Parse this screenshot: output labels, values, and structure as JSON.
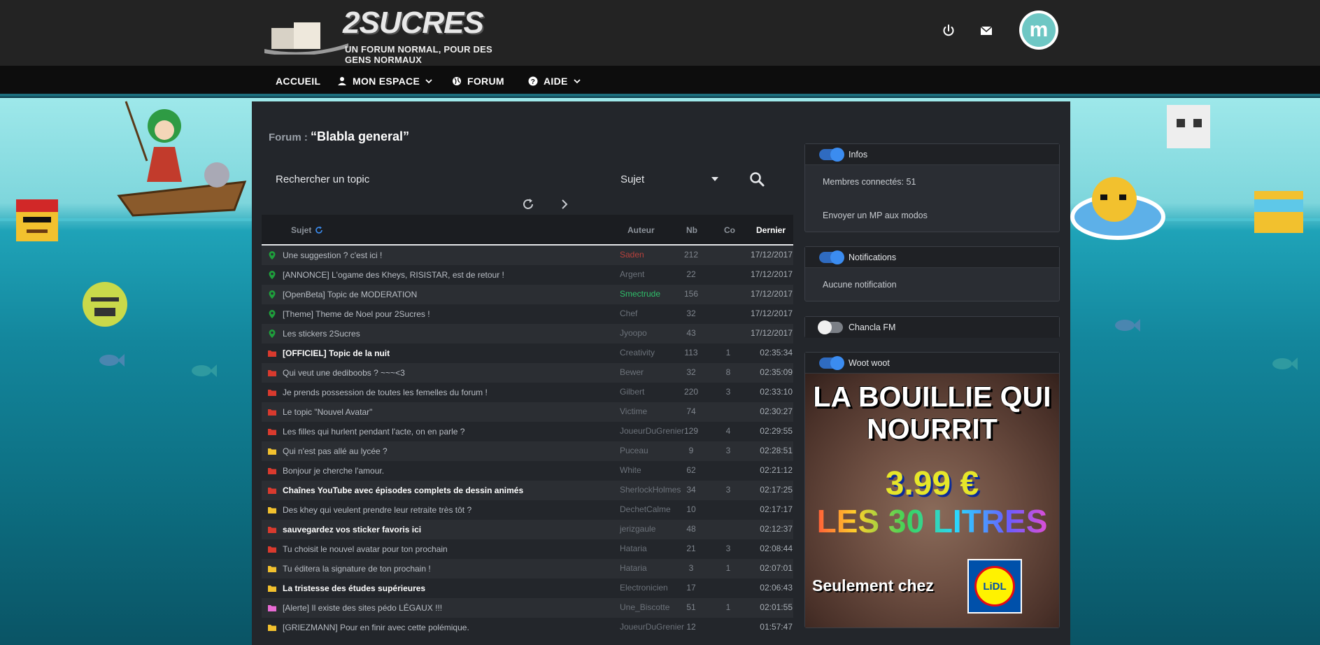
{
  "site": {
    "title": "2SUCRES",
    "tagline": "UN FORUM NORMAL, POUR DES GENS NORMAUX",
    "avatar_letter": "m"
  },
  "nav": {
    "home": "ACCUEIL",
    "space": "MON ESPACE",
    "forum": "FORUM",
    "help": "AIDE"
  },
  "breadcrumb": {
    "prefix": "Forum :",
    "title": "“Blabla general”"
  },
  "search": {
    "label": "Rechercher un topic",
    "field_value": "Sujet"
  },
  "table": {
    "headers": {
      "subject": "Sujet",
      "author": "Auteur",
      "nb": "Nb",
      "co": "Co",
      "last": "Dernier"
    },
    "rows": [
      {
        "icon": "pin",
        "color": "#1f9e3c",
        "subject": "Une suggestion ? c'est ici !",
        "bold": false,
        "author": "Saden",
        "author_color": "#b8413c",
        "nb": "212",
        "co": "",
        "date": "17/12/2017"
      },
      {
        "icon": "pin",
        "color": "#1f9e3c",
        "subject": "[ANNONCE] L'ogame des Kheys, RISISTAR, est de retour !",
        "bold": false,
        "author": "Argent",
        "author_color": "",
        "nb": "22",
        "co": "",
        "date": "17/12/2017"
      },
      {
        "icon": "pin",
        "color": "#1f9e3c",
        "subject": "[OpenBeta] Topic de MODERATION",
        "bold": false,
        "author": "Smectrude",
        "author_color": "#2fbf6a",
        "nb": "156",
        "co": "",
        "date": "17/12/2017"
      },
      {
        "icon": "pin",
        "color": "#1f9e3c",
        "subject": "[Theme] Theme de Noel pour 2Sucres !",
        "bold": false,
        "author": "Chef",
        "author_color": "",
        "nb": "32",
        "co": "",
        "date": "17/12/2017"
      },
      {
        "icon": "pin",
        "color": "#1f9e3c",
        "subject": "Les stickers 2Sucres",
        "bold": false,
        "author": "Jyoopo",
        "author_color": "",
        "nb": "43",
        "co": "",
        "date": "17/12/2017"
      },
      {
        "icon": "folder",
        "color": "#d93a2e",
        "subject": "[OFFICIEL] Topic de la nuit",
        "bold": true,
        "author": "Creativity",
        "author_color": "",
        "nb": "113",
        "co": "1",
        "date": "02:35:34"
      },
      {
        "icon": "folder",
        "color": "#d93a2e",
        "subject": "Qui veut une dediboobs ? ~~~<3",
        "bold": false,
        "author": "Bewer",
        "author_color": "",
        "nb": "32",
        "co": "8",
        "date": "02:35:09"
      },
      {
        "icon": "folder",
        "color": "#d93a2e",
        "subject": "Je prends possession de toutes les femelles du forum !",
        "bold": false,
        "author": "Gilbert",
        "author_color": "",
        "nb": "220",
        "co": "3",
        "date": "02:33:10"
      },
      {
        "icon": "folder",
        "color": "#d93a2e",
        "subject": "Le topic \"Nouvel Avatar\"",
        "bold": false,
        "author": "Victime",
        "author_color": "",
        "nb": "74",
        "co": "",
        "date": "02:30:27"
      },
      {
        "icon": "folder",
        "color": "#d93a2e",
        "subject": "Les filles qui hurlent pendant l'acte, on en parle ?",
        "bold": false,
        "author": "JoueurDuGrenier",
        "author_color": "",
        "nb": "129",
        "co": "4",
        "date": "02:29:55"
      },
      {
        "icon": "folder",
        "color": "#f2c12e",
        "subject": "Qui n'est pas allé au lycée ?",
        "bold": false,
        "author": "Puceau",
        "author_color": "",
        "nb": "9",
        "co": "3",
        "date": "02:28:51"
      },
      {
        "icon": "folder",
        "color": "#d93a2e",
        "subject": "Bonjour je cherche l'amour.",
        "bold": false,
        "author": "White",
        "author_color": "",
        "nb": "62",
        "co": "",
        "date": "02:21:12"
      },
      {
        "icon": "folder",
        "color": "#d93a2e",
        "subject": "Chaînes YouTube avec épisodes complets de dessin animés",
        "bold": true,
        "author": "SherlockHolmes",
        "author_color": "",
        "nb": "34",
        "co": "3",
        "date": "02:17:25"
      },
      {
        "icon": "folder",
        "color": "#f2c12e",
        "subject": "Des khey qui veulent prendre leur retraite très tôt ?",
        "bold": false,
        "author": "DechetCalme",
        "author_color": "",
        "nb": "10",
        "co": "",
        "date": "02:17:17"
      },
      {
        "icon": "folder",
        "color": "#d93a2e",
        "subject": "sauvegardez vos sticker favoris ici",
        "bold": true,
        "author": "jerizgaule",
        "author_color": "",
        "nb": "48",
        "co": "",
        "date": "02:12:37"
      },
      {
        "icon": "folder",
        "color": "#d93a2e",
        "subject": "Tu choisit le nouvel avatar pour ton prochain",
        "bold": false,
        "author": "Hataria",
        "author_color": "",
        "nb": "21",
        "co": "3",
        "date": "02:08:44"
      },
      {
        "icon": "folder",
        "color": "#f2c12e",
        "subject": "Tu éditera la signature de ton prochain !",
        "bold": false,
        "author": "Hataria",
        "author_color": "",
        "nb": "3",
        "co": "1",
        "date": "02:07:01"
      },
      {
        "icon": "folder",
        "color": "#f2c12e",
        "subject": "La tristesse des études supérieures",
        "bold": true,
        "author": "Electronicien",
        "author_color": "",
        "nb": "17",
        "co": "",
        "date": "02:06:43"
      },
      {
        "icon": "folder",
        "color": "#e86bd4",
        "subject": "[Alerte] Il existe des sites pédo LÉGAUX !!!",
        "bold": false,
        "author": "Une_Biscotte",
        "author_color": "",
        "nb": "51",
        "co": "1",
        "date": "02:01:55"
      },
      {
        "icon": "folder",
        "color": "#f2c12e",
        "subject": "[GRIEZMANN] Pour en finir avec cette polémique.",
        "bold": false,
        "author": "JoueurDuGrenier",
        "author_color": "",
        "nb": "12",
        "co": "",
        "date": "01:57:47"
      }
    ]
  },
  "sidebar": {
    "infos": {
      "title": "Infos",
      "members": "Membres connectés: 51",
      "mp": "Envoyer un MP aux modos"
    },
    "notifications": {
      "title": "Notifications",
      "empty": "Aucune notification"
    },
    "radio": {
      "title": "Chancla FM"
    },
    "woot": {
      "title": "Woot woot"
    },
    "ad": {
      "line1": "LA BOUILLIE QUI",
      "line2": "NOURRIT",
      "price": "3.99 €",
      "litres": "LES 30 LITRES",
      "only": "Seulement chez",
      "brand": "LiDL"
    }
  },
  "colors": {
    "accent": "#1d6e7d",
    "toggle_on": "#3b8cf0"
  }
}
